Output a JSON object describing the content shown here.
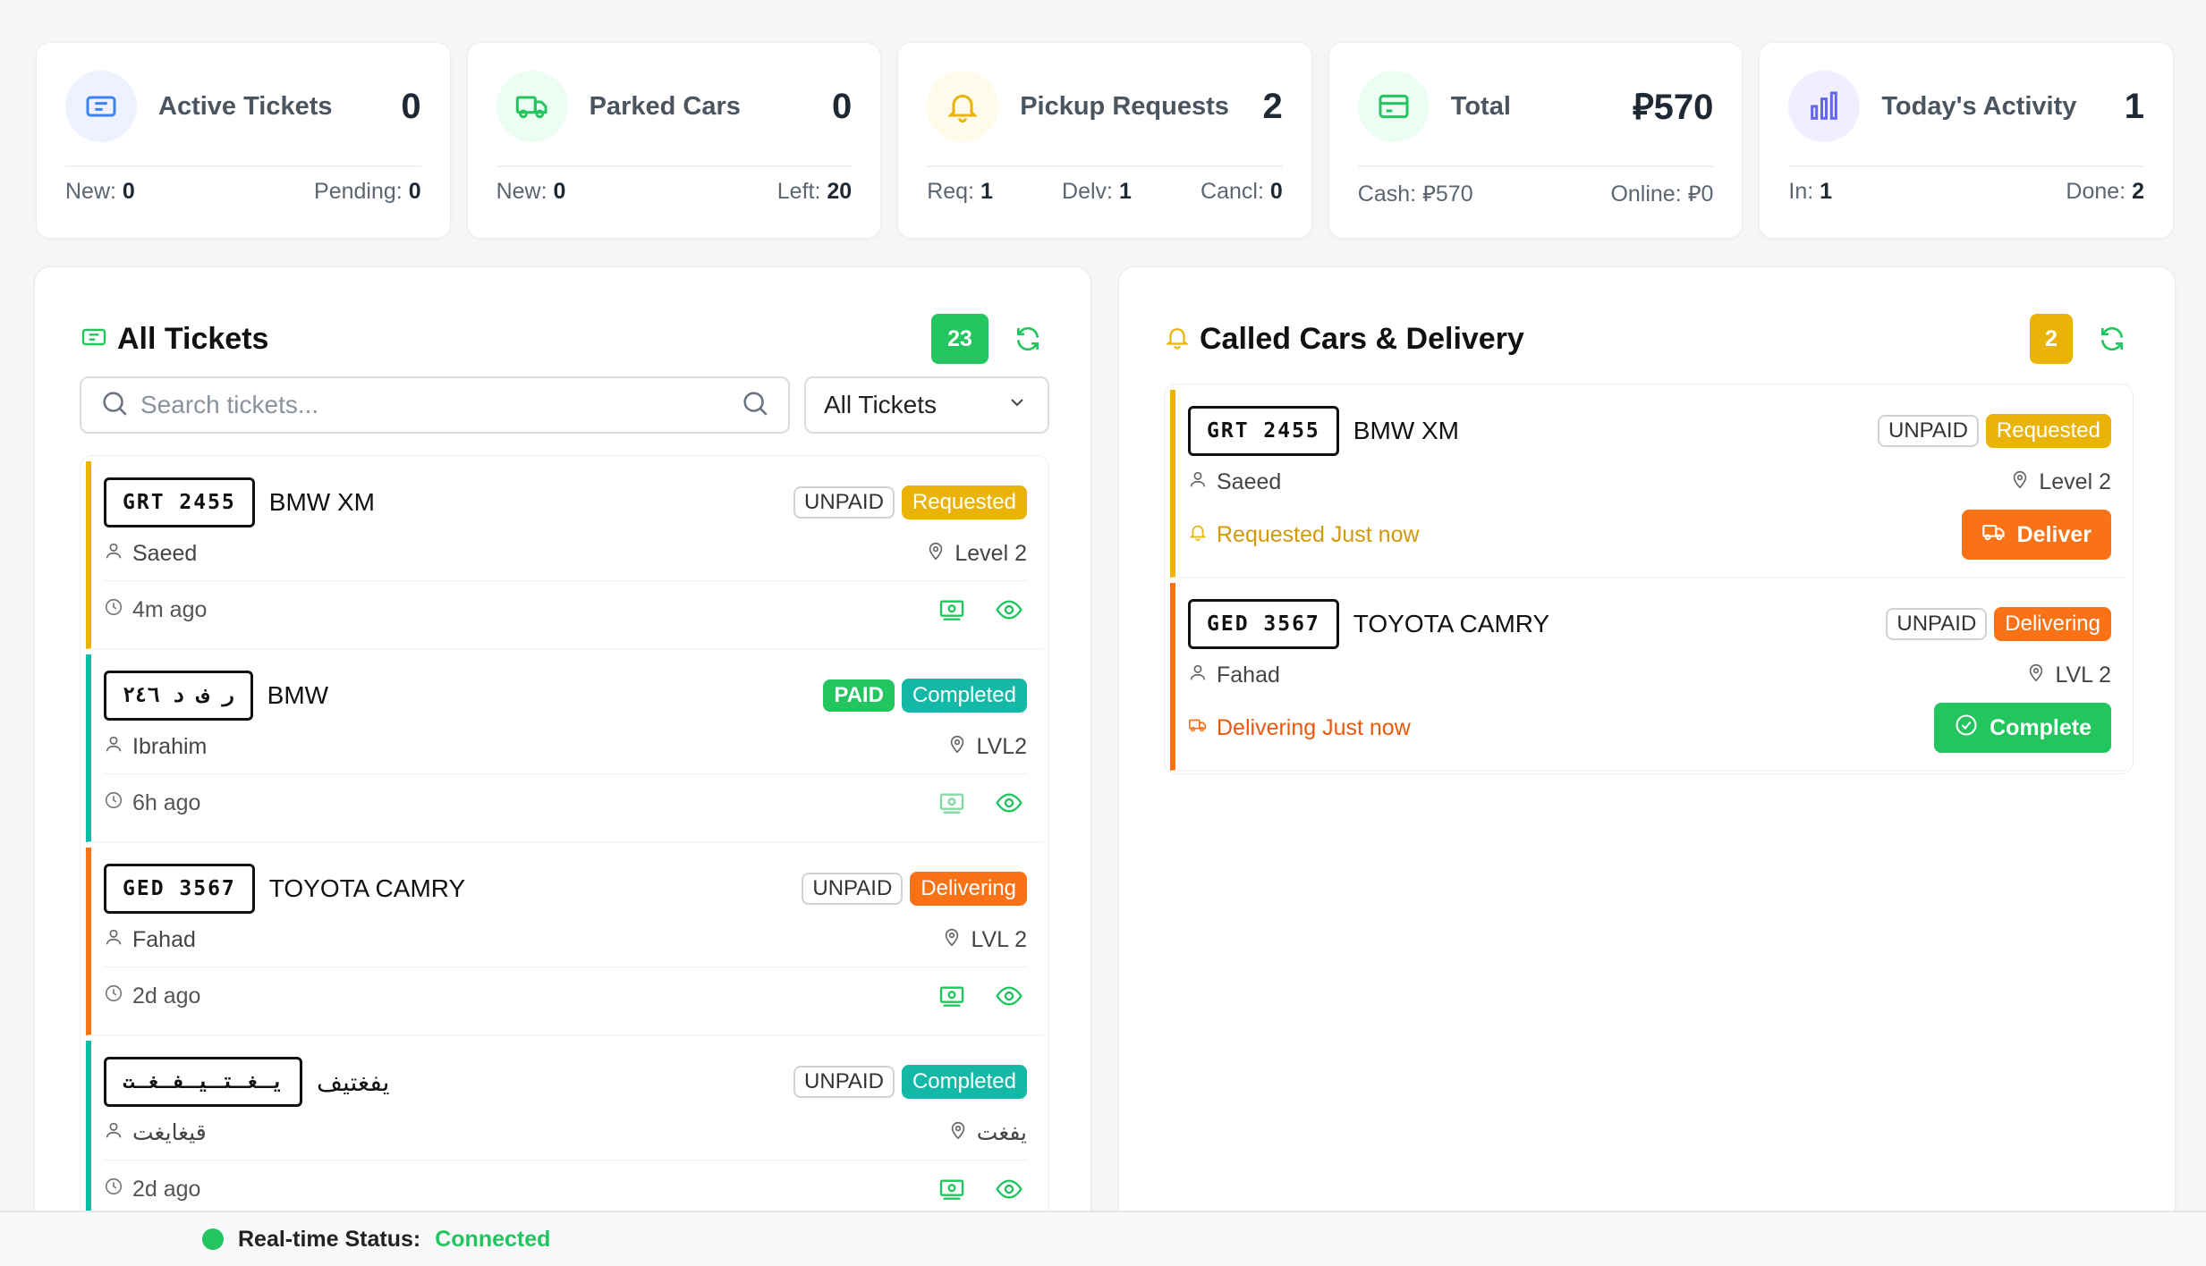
{
  "colors": {
    "yellow": "#eab308",
    "green": "#22c55e",
    "teal": "#14b8a6",
    "orange": "#f97316"
  },
  "stats": [
    {
      "icon": "ticket-icon",
      "title": "Active Tickets",
      "value": "0",
      "bottom": [
        {
          "label": "New:",
          "value": "0"
        },
        {
          "label": "Pending:",
          "value": "0"
        }
      ]
    },
    {
      "icon": "truck-icon",
      "title": "Parked Cars",
      "value": "0",
      "bottom": [
        {
          "label": "New:",
          "value": "0"
        },
        {
          "label": "Left:",
          "value": "20"
        }
      ]
    },
    {
      "icon": "bell-icon",
      "title": "Pickup Requests",
      "value": "2",
      "bottom": [
        {
          "label": "Req:",
          "value": "1"
        },
        {
          "label": "Delv:",
          "value": "1"
        },
        {
          "label": "Cancl:",
          "value": "0"
        }
      ]
    },
    {
      "icon": "card-icon",
      "title": "Total",
      "value": "⃁570",
      "bottom": [
        {
          "label": "Cash:",
          "value": "⃁570"
        },
        {
          "label": "Online:",
          "value": "⃁0"
        }
      ]
    },
    {
      "icon": "bar-chart-icon",
      "title": "Today's Activity",
      "value": "1",
      "bottom": [
        {
          "label": "In:",
          "value": "1"
        },
        {
          "label": "Done:",
          "value": "2"
        }
      ]
    }
  ],
  "all_tickets": {
    "title": "All Tickets",
    "count": "23",
    "search_placeholder": "Search tickets...",
    "filter": "All Tickets",
    "items": [
      {
        "plate": "GRT 2455",
        "model": "BMW XM",
        "payment": "UNPAID",
        "status": "Requested",
        "owner": "Saeed",
        "location": "Level 2",
        "time": "4m ago"
      },
      {
        "plate": "ر ف د ٢٤٦",
        "model": "BMW",
        "payment": "PAID",
        "status": "Completed",
        "owner": "Ibrahim",
        "location": "LVL2",
        "time": "6h ago"
      },
      {
        "plate": "GED 3567",
        "model": "TOYOTA CAMRY",
        "payment": "UNPAID",
        "status": "Delivering",
        "owner": "Fahad",
        "location": "LVL 2",
        "time": "2d ago"
      },
      {
        "plate": "يـغـتـيـفـغـت",
        "model": "يفغتيف",
        "payment": "UNPAID",
        "status": "Completed",
        "owner": "قيغايغت",
        "location": "يفغت",
        "time": "2d ago"
      }
    ]
  },
  "called_cars": {
    "title": "Called Cars & Delivery",
    "count": "2",
    "items": [
      {
        "plate": "GRT 2455",
        "model": "BMW XM",
        "payment": "UNPAID",
        "status": "Requested",
        "owner": "Saeed",
        "location": "Level 2",
        "message": "Requested Just now",
        "action": "Deliver"
      },
      {
        "plate": "GED 3567",
        "model": "TOYOTA CAMRY",
        "payment": "UNPAID",
        "status": "Delivering",
        "owner": "Fahad",
        "location": "LVL 2",
        "message": "Delivering Just now",
        "action": "Complete"
      }
    ]
  },
  "footer": {
    "label": "Real-time Status:",
    "value": "Connected"
  }
}
